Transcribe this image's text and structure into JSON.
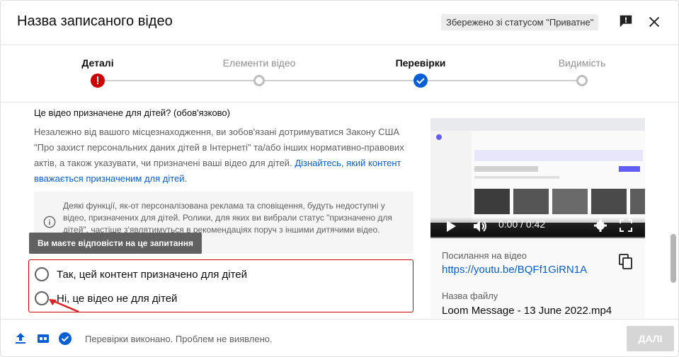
{
  "header": {
    "title": "Назва записаного відео",
    "status_chip": "Збережено зі статусом \"Приватне\""
  },
  "steps": [
    {
      "label": "Деталі",
      "state": "error"
    },
    {
      "label": "Елементи відео",
      "state": "pending"
    },
    {
      "label": "Перевірки",
      "state": "done"
    },
    {
      "label": "Видимість",
      "state": "pending"
    }
  ],
  "audience": {
    "heading": "Це відео призначене для дітей? (обов'язково)",
    "description": "Незалежно від вашого місцезнаходження, ви зобов'язані дотримуватися Закону США \"Про захист персональних даних дітей в Інтернеті\" та/або інших нормативно-правових актів, а також указувати, чи призначені ваші відео для дітей.",
    "learn_more": "Дізнайтесь, який контент вважається призначеним для дітей.",
    "info": "Деякі функції, як-от персоналізована реклама та сповіщення, будуть недоступні у відео, призначених для дітей. Ролики, для яких ви вибрали статус \"призначено для дітей\", частіше з'являтимуться в рекомендаціях поруч з іншими дитячими відео.",
    "tooltip": "Ви маєте відповісти на це запитання",
    "options": [
      {
        "label": "Так, цей контент призначено для дітей",
        "selected": false
      },
      {
        "label": "Ні, це відео не для дітей",
        "selected": false
      }
    ]
  },
  "preview": {
    "time": "0:00 / 0:42",
    "progress_fraction": 0,
    "link_label": "Посилання на відео",
    "link": "https://youtu.be/BQFf1GiRN1A",
    "file_label": "Назва файлу",
    "file_name": "Loom Message - 13 June 2022.mp4"
  },
  "footer": {
    "status": "Перевірки виконано. Проблем не виявлено.",
    "next_button": "ДАЛІ"
  },
  "colors": {
    "accent": "#065fd4",
    "error": "#cc0000",
    "text_secondary": "#606060"
  }
}
